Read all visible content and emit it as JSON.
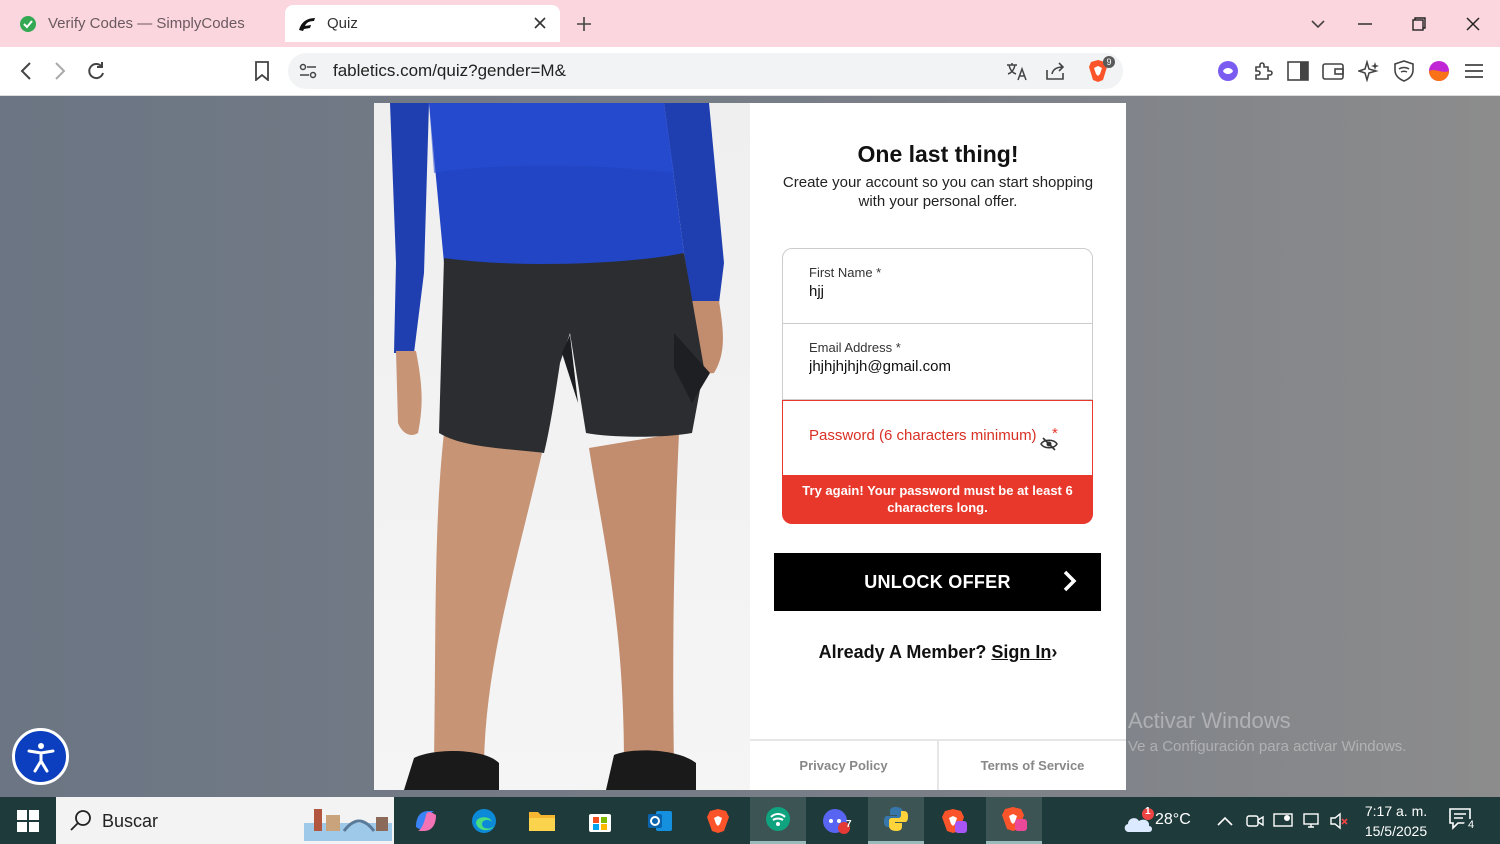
{
  "browser": {
    "tabs": [
      {
        "label": "Verify Codes — SimplyCodes",
        "active": false
      },
      {
        "label": "Quiz",
        "active": true
      }
    ],
    "url": "fabletics.com/quiz?gender=M&",
    "shield_badge": "9"
  },
  "modal": {
    "title": "One last thing!",
    "subtitle": "Create your account so you can start shopping with your personal offer.",
    "fields": {
      "first_name_label": "First Name *",
      "first_name_value": "hjj",
      "email_label": "Email Address *",
      "email_value": "jhjhjhjhjh@gmail.com",
      "password_placeholder": "Password (6 characters minimum)",
      "password_required": "*"
    },
    "error_message": "Try again! Your password must be at least 6 characters long.",
    "cta_label": "UNLOCK OFFER",
    "member_text": "Already A Member?",
    "signin_label": "Sign In",
    "signin_chevron": "›",
    "footer": {
      "privacy": "Privacy Policy",
      "terms": "Terms of Service"
    }
  },
  "watermark": {
    "line1": "Activar Windows",
    "line2": "Ve a Configuración para activar Windows."
  },
  "taskbar": {
    "search_placeholder": "Buscar",
    "weather_badge": "1",
    "temperature": "28°C",
    "time": "7:17 a. m.",
    "date": "15/5/2025",
    "notification_count": "4",
    "chat_badge": "7"
  },
  "colors": {
    "error": "#e8382b",
    "cta": "#000000",
    "tab_strip": "#fcd6de",
    "taskbar": "#1f3a3a"
  }
}
